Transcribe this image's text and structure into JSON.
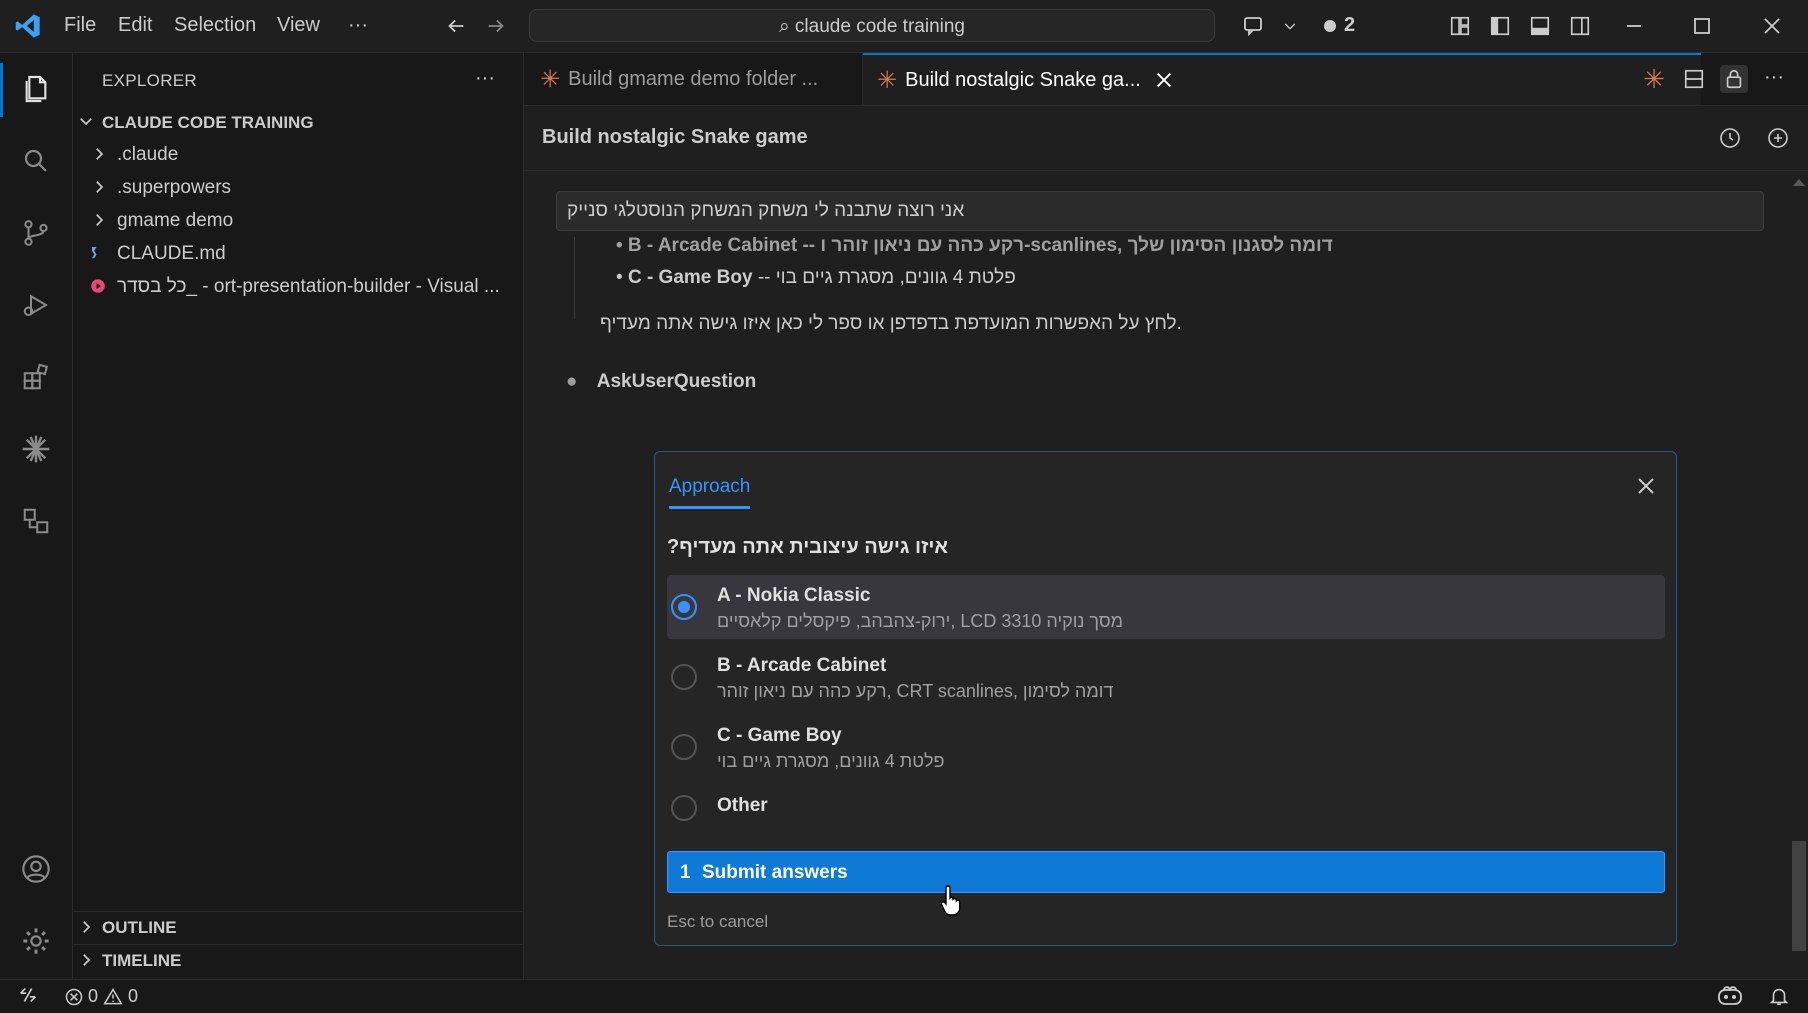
{
  "titlebar": {
    "menu": [
      "File",
      "Edit",
      "Selection",
      "View",
      "···"
    ],
    "search_text": "claude code training",
    "badge_count": "2"
  },
  "sidebar": {
    "title": "EXPLORER",
    "more": "···",
    "root": "CLAUDE CODE TRAINING",
    "items": [
      {
        "label": ".claude",
        "type": "folder"
      },
      {
        "label": ".superpowers",
        "type": "folder"
      },
      {
        "label": "gmame demo",
        "type": "folder"
      },
      {
        "label": "CLAUDE.md",
        "type": "file"
      },
      {
        "label": "כל בסדר_ - ort-presentation-builder - Visual ...",
        "type": "file"
      }
    ],
    "outline": "OUTLINE",
    "timeline": "TIMELINE"
  },
  "tabs": [
    {
      "label": "Build gmame demo folder ...",
      "active": false
    },
    {
      "label": "Build nostalgic Snake ga...",
      "active": true
    }
  ],
  "panel": {
    "title": "Build nostalgic Snake game"
  },
  "chat": {
    "prompt": "אני רוצה שתבנה לי משחק המשחק הנוסטלגי סנייק",
    "line_b": "• B - Arcade Cabinet -- רקע כהה עם ניאון זוהר ו-scanlines, דומה לסגנון הסימון שלך",
    "line_c_bold": "C - Game Boy",
    "line_c_rest": " -- פלטת 4 גוונים, מסגרת גיים בוי",
    "instruction": "לחץ על האפשרות המועדפת בדפדפן או ספר לי כאן איזו גישה אתה מעדיף.",
    "tool_name": "AskUserQuestion"
  },
  "dialog": {
    "tab_label": "Approach",
    "question": "?איזו גישה עיצובית אתה מעדיף",
    "options": [
      {
        "title": "A - Nokia Classic",
        "desc": "ירוק-צהבהב, פיקסלים קלאסיים, LCD מסך נוקיה 3310",
        "selected": true
      },
      {
        "title": "B - Arcade Cabinet",
        "desc": "רקע כהה עם ניאון זוהר, CRT scanlines, דומה לסימון",
        "selected": false
      },
      {
        "title": "C - Game Boy",
        "desc": "פלטת 4 גוונים, מסגרת גיים בוי",
        "selected": false
      },
      {
        "title": "Other",
        "desc": "",
        "selected": false
      }
    ],
    "submit_number": "1",
    "submit_label": "Submit answers",
    "esc_hint": "Esc to cancel"
  },
  "status": {
    "errors": "0",
    "warnings": "0"
  },
  "colors": {
    "accent": "#0078d4",
    "link": "#3794ff",
    "claude": "#d97757",
    "git_error": "#e9467a"
  }
}
